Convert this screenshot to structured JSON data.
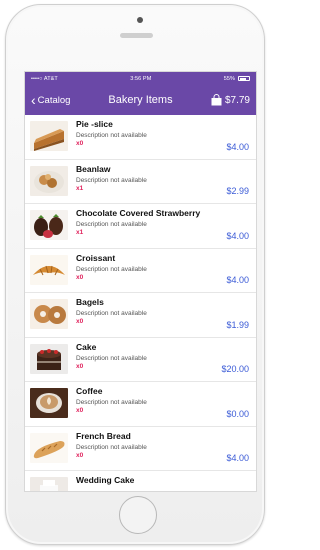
{
  "status_bar": {
    "carrier": "••••○ AT&T",
    "time": "3:56 PM",
    "battery": "55%"
  },
  "nav": {
    "back_label": "Catalog",
    "title": "Bakery Items",
    "cart_total": "$7.79"
  },
  "colors": {
    "nav_bg": "#6a48a7",
    "quantity": "#e0245e",
    "price": "#3b5bd6"
  },
  "items": [
    {
      "name": "Pie -slice",
      "description": "Description not available",
      "quantity": "x0",
      "price": "$4.00",
      "icon": "pie-slice-image"
    },
    {
      "name": "Beanlaw",
      "description": "Description not available",
      "quantity": "x1",
      "price": "$2.99",
      "icon": "beanlaw-image"
    },
    {
      "name": "Chocolate Covered Strawberry",
      "description": "Description not available",
      "quantity": "x1",
      "price": "$4.00",
      "icon": "chocolate-strawberry-image"
    },
    {
      "name": "Croissant",
      "description": "Description not available",
      "quantity": "x0",
      "price": "$4.00",
      "icon": "croissant-image"
    },
    {
      "name": "Bagels",
      "description": "Description not available",
      "quantity": "x0",
      "price": "$1.99",
      "icon": "bagels-image"
    },
    {
      "name": "Cake",
      "description": "Description not available",
      "quantity": "x0",
      "price": "$20.00",
      "icon": "cake-image"
    },
    {
      "name": "Coffee",
      "description": "Description not available",
      "quantity": "x0",
      "price": "$0.00",
      "icon": "coffee-image"
    },
    {
      "name": "French Bread",
      "description": "Description not available",
      "quantity": "x0",
      "price": "$4.00",
      "icon": "french-bread-image"
    },
    {
      "name": "Wedding Cake",
      "description": "",
      "quantity": "",
      "price": "",
      "icon": "wedding-cake-image"
    }
  ]
}
